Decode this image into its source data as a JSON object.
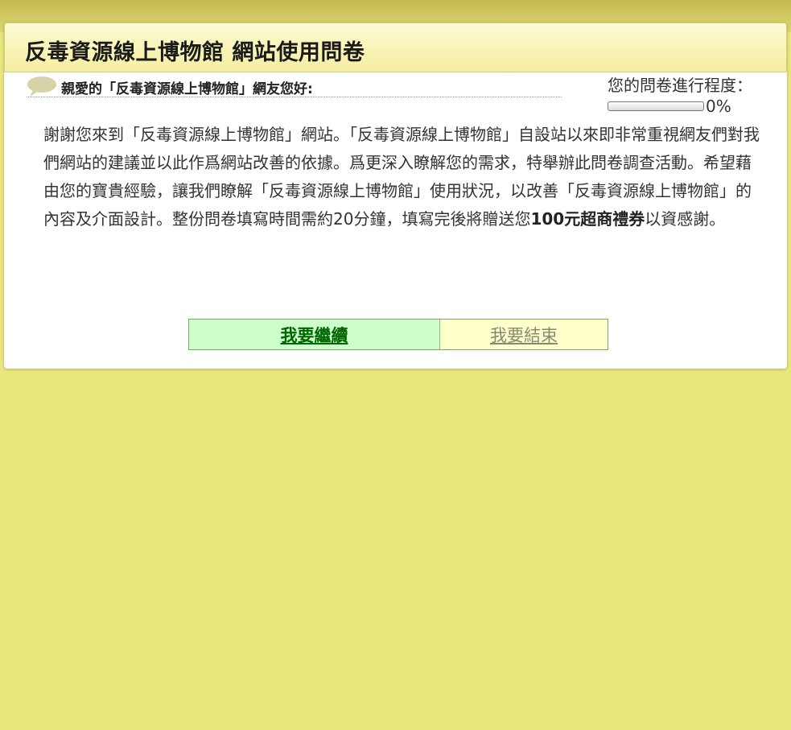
{
  "header": {
    "title": "反毒資源線上博物館 網站使用問卷"
  },
  "greeting": {
    "icon": "speech-bubble-icon",
    "text": "親愛的「反毒資源線上博物館」網友您好:"
  },
  "progress": {
    "label": "您的問卷進行程度：",
    "value": 0,
    "percent_text": "0%"
  },
  "intro": {
    "part1": "謝謝您來到「反毒資源線上博物館」網站。「反毒資源線上博物館」自設站以來即非常重視網友們對我們網站的建議並以此作爲網站改善的依據。爲更深入瞭解您的需求，特舉辦此問卷調查活動。希望藉由您的寶貴經驗，讓我們瞭解「反毒資源線上博物館」使用狀況，以改善「反毒資源線上博物館」的內容及介面設計。整份問卷填寫時間需約20分鐘，填寫完後將贈送您",
    "highlight": "100元超商禮券",
    "part2": "以資感謝。"
  },
  "actions": {
    "continue_label": "我要繼續",
    "end_label": "我要結束"
  },
  "colors": {
    "page_background": "#e9e67d",
    "continue_bg": "#ccffcc",
    "continue_text": "#006600",
    "end_bg": "#ffffcc"
  }
}
